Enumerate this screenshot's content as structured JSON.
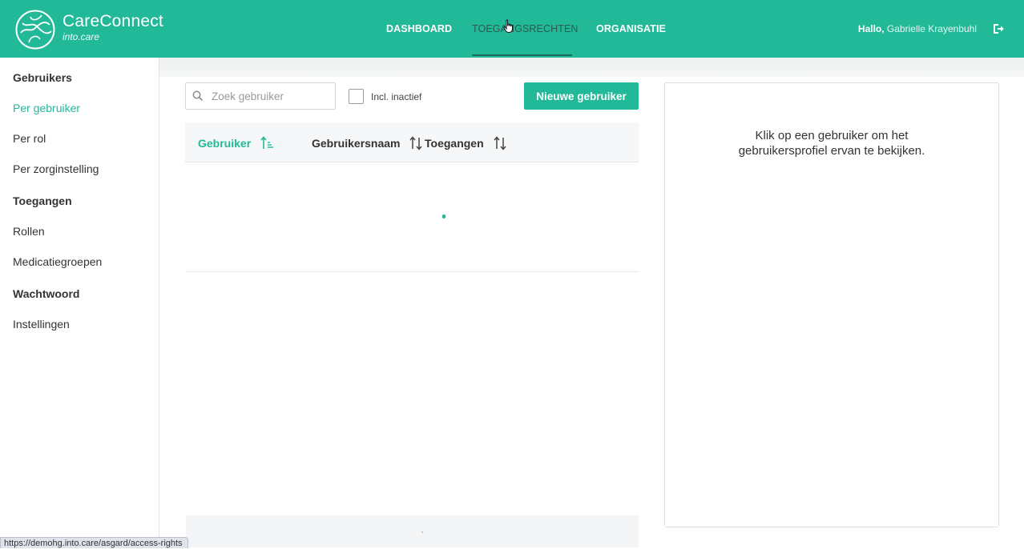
{
  "header": {
    "brand_name": "CareConnect",
    "brand_sub": "into.care",
    "nav": [
      {
        "label": "DASHBOARD",
        "active": false
      },
      {
        "label": "TOEGANGSRECHTEN",
        "active": true
      },
      {
        "label": "ORGANISATIE",
        "active": false
      }
    ],
    "greeting": "Hallo,",
    "user_name": "Gabrielle Krayenbuhl",
    "logout_icon": "logout-icon"
  },
  "sidebar": {
    "sections": [
      {
        "heading": "Gebruikers",
        "items": [
          "Per gebruiker",
          "Per rol",
          "Per zorginstelling"
        ],
        "active": "Per gebruiker"
      },
      {
        "heading": "Toegangen",
        "items": [
          "Rollen",
          "Medicatiegroepen"
        ]
      },
      {
        "heading": "Wachtwoord",
        "items": [
          "Instellingen"
        ]
      }
    ]
  },
  "list": {
    "search_placeholder": "Zoek gebruiker",
    "include_inactive_label": "Incl. inactief",
    "include_inactive_checked": false,
    "new_user_button": "Nieuwe gebruiker",
    "columns": [
      {
        "label": "Gebruiker",
        "sorted": "ascending"
      },
      {
        "label": "Gebruikersnaam",
        "sorted": null
      },
      {
        "label": "Toegangen",
        "sorted": null
      }
    ],
    "rows": []
  },
  "detail": {
    "message_line1": "Klik op een gebruiker om het",
    "message_line2": "gebruikersprofiel ervan te bekijken."
  },
  "statusbar": {
    "url": "https://demohg.into.care/asgard/access-rights"
  },
  "colors": {
    "brand": "#21b998",
    "nav_active_text": "#2c5a50",
    "text": "#333333"
  }
}
